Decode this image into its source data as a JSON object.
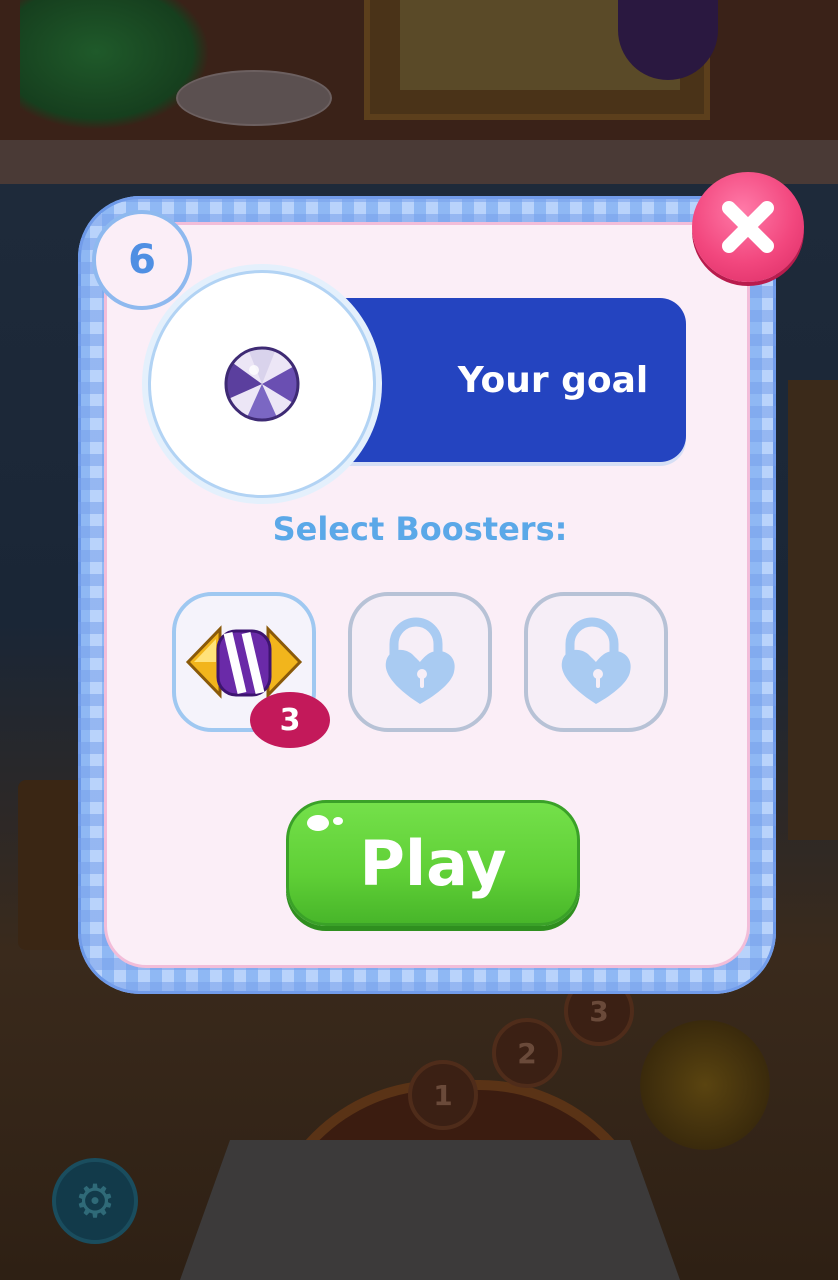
{
  "level": {
    "number": "6"
  },
  "goal": {
    "title": "Your goal",
    "target_icon": "beach-ball-icon"
  },
  "boosters": {
    "title": "Select Boosters:",
    "slots": [
      {
        "icon": "candy-booster-icon",
        "count": "3",
        "locked": false
      },
      {
        "icon": "padlock-heart-icon",
        "locked": true
      },
      {
        "icon": "padlock-heart-icon",
        "locked": true
      }
    ]
  },
  "buttons": {
    "play_label": "Play",
    "close_icon": "close-icon"
  },
  "map": {
    "level_nodes": [
      "1",
      "2",
      "3"
    ],
    "settings_icon": "gear-icon"
  },
  "colors": {
    "banner_blue": "#2444c0",
    "accent_light_blue": "#5ba8e8",
    "close_pink": "#f2477e",
    "play_green": "#5fcf36",
    "badge_crimson": "#c3195a",
    "dialog_pink": "#fbeef7"
  }
}
